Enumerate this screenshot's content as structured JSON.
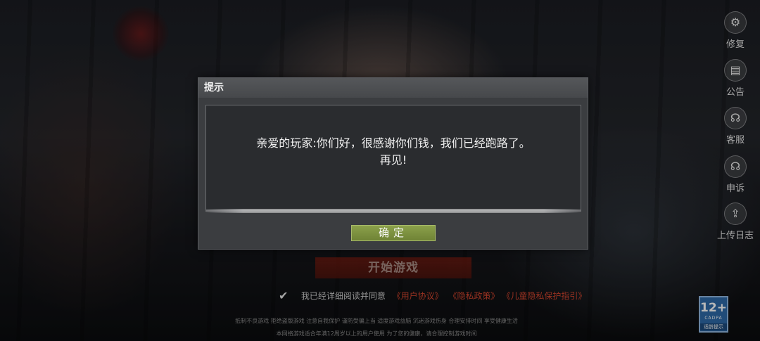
{
  "side_menu": [
    {
      "label": "修复",
      "icon": "gear-icon",
      "glyph": "⚙"
    },
    {
      "label": "公告",
      "icon": "notice-icon",
      "glyph": "▤"
    },
    {
      "label": "客服",
      "icon": "headset-icon",
      "glyph": "☊"
    },
    {
      "label": "申诉",
      "icon": "headset-appeal-icon",
      "glyph": "☊"
    },
    {
      "label": "上传日志",
      "icon": "upload-icon",
      "glyph": "⇪"
    }
  ],
  "start_button": {
    "label": "开始游戏"
  },
  "agreement": {
    "text": "我已经详细阅读并同意",
    "links": [
      "《用户协议》",
      "《隐私政策》",
      "《儿童隐私保护指引》"
    ]
  },
  "footer": {
    "line1": "抵制不良游戏  拒绝盗版游戏  注意自我保护  谨防受骗上当  适度游戏益脑  沉迷游戏伤身  合理安排时间  享受健康生活",
    "line2": "本网络游戏适合年满12周岁以上的用户使用    为了您的健康，请合理控制游戏时间"
  },
  "age_rating": {
    "age": "12+",
    "org": "CADPA",
    "tip": "适龄提示"
  },
  "dialog": {
    "title": "提示",
    "message_line1": "亲爱的玩家:你们好，很感谢你们钱，我们已经跑路了。",
    "message_line2": "再见!",
    "confirm_label": "确定"
  },
  "colors": {
    "confirm_button": "#7f943f",
    "link_red": "#d2452e",
    "dialog_bg": "#3b3d40",
    "age_badge_blue": "#2f6aa8"
  }
}
